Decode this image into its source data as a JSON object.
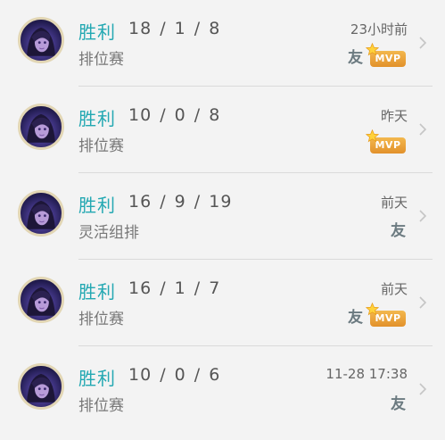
{
  "matches": [
    {
      "result": "胜利",
      "kda": "18 / 1 / 8",
      "mode": "排位赛",
      "time": "23小时前",
      "friend": "友",
      "mvp": "MVP"
    },
    {
      "result": "胜利",
      "kda": "10 / 0 / 8",
      "mode": "排位赛",
      "time": "昨天",
      "friend": "",
      "mvp": "MVP"
    },
    {
      "result": "胜利",
      "kda": "16 / 9 / 19",
      "mode": "灵活组排",
      "time": "前天",
      "friend": "友",
      "mvp": ""
    },
    {
      "result": "胜利",
      "kda": "16 / 1 / 7",
      "mode": "排位赛",
      "time": "前天",
      "friend": "友",
      "mvp": "MVP"
    },
    {
      "result": "胜利",
      "kda": "10 / 0 / 6",
      "mode": "排位赛",
      "time": "11-28 17:38",
      "friend": "友",
      "mvp": ""
    }
  ],
  "colors": {
    "win": "#23a8b2",
    "mvp": "#e9a238",
    "background": "#f3f3f3"
  },
  "icons": {
    "avatar": "hero-portrait-avatar",
    "chevron": "chevron-right-icon",
    "mvp_star": "star-icon"
  }
}
